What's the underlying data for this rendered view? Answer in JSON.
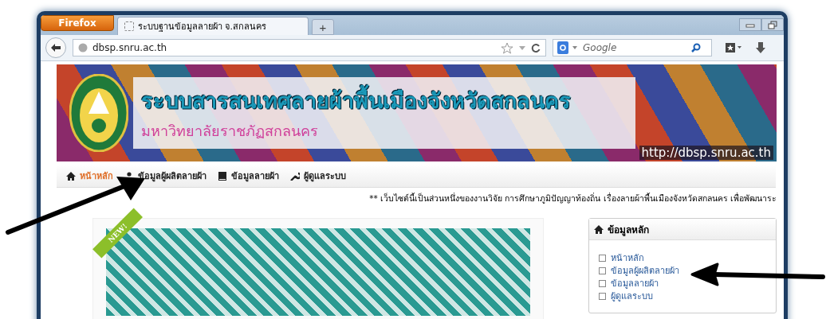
{
  "browser": {
    "menu_button": "Firefox",
    "tabs": [
      {
        "title": "ระบบฐานข้อมูลลายผ้า จ.สกลนคร",
        "selected": true
      }
    ],
    "new_tab": "+",
    "address": "dbsp.snru.ac.th",
    "search": {
      "placeholder": "Google"
    }
  },
  "banner": {
    "title": "ระบบสารสนเทศลายผ้าพื้นเมืองจังหวัดสกลนคร",
    "subtitle": "มหาวิทยาลัยราชภัฏสกลนคร",
    "url": "http://dbsp.snru.ac.th"
  },
  "nav": [
    {
      "label": "หน้าหลัก",
      "selected": true
    },
    {
      "label": "ข้อมูลผู้ผลิตลายผ้า",
      "selected": false
    },
    {
      "label": "ข้อมูลลายผ้า",
      "selected": false
    },
    {
      "label": "ผู้ดูแลระบบ",
      "selected": false
    }
  ],
  "marquee": "** เว็บไซต์นี้เป็นส่วนหนึ่งของงานวิจัย การศึกษาภูมิปัญญาท้องถิ่น เรื่องลายผ้าพื้นเมืองจังหวัดสกลนคร เพื่อพัฒนาระ",
  "slide": {
    "ribbon": "NEW!"
  },
  "sidebar": {
    "title": "ข้อมูลหลัก",
    "links": [
      "หน้าหลัก",
      "ข้อมูลผู้ผลิตลายผ้า",
      "ข้อมูลลายผ้า",
      "ผู้ดูแลระบบ"
    ]
  }
}
